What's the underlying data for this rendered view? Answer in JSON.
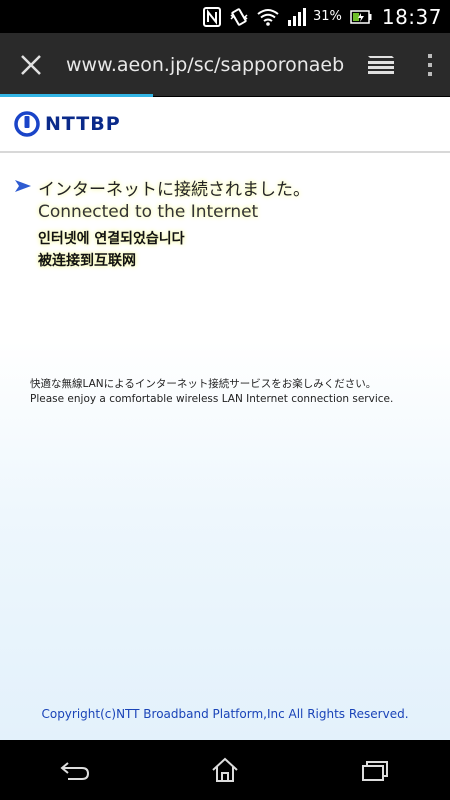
{
  "status_bar": {
    "icons": [
      "nfc-icon",
      "vibrate-icon",
      "wifi-icon",
      "signal-icon",
      "battery-icon"
    ],
    "battery_percent": "31%",
    "time": "18:37"
  },
  "browser": {
    "url": "www.aeon.jp/sc/sapporonaeb",
    "load_progress": 0.34,
    "accent_color": "#33b5e5"
  },
  "page": {
    "logo_text": "NTTBP",
    "messages": {
      "japanese": "インターネットに接続されました。",
      "english": "Connected to the Internet",
      "korean": "인터넷에 연결되었습니다",
      "chinese": "被连接到互联网"
    },
    "service_ja": "快適な無線LANによるインターネット接続サービスをお楽しみください。",
    "service_en": "Please enjoy a comfortable wireless LAN Internet connection service.",
    "copyright": "Copyright(c)NTT Broadband Platform,Inc All Rights Reserved."
  },
  "nav_bar": {
    "buttons": [
      "back-icon",
      "home-icon",
      "recent-apps-icon"
    ]
  }
}
